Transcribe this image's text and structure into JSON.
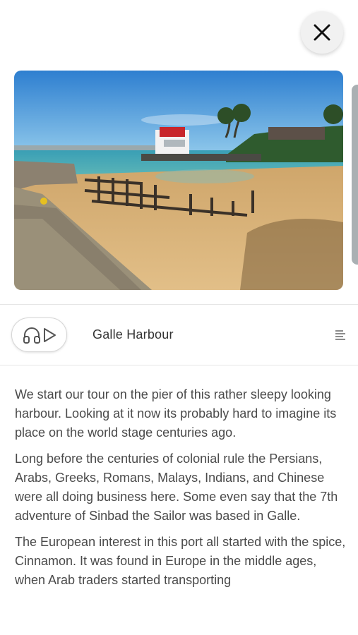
{
  "header": {
    "close_icon": "close-icon"
  },
  "carousel": {
    "photo_alt": "Galle Harbour",
    "colors": {
      "sky": "#3d8fd8",
      "sea": "#3fa6b8",
      "sand": "#d9b47a"
    }
  },
  "player": {
    "audio_icons": [
      "headphones-icon",
      "play-icon"
    ],
    "stop_title": "Galle Harbour",
    "transcript_icon": "text-align-icon"
  },
  "article": {
    "paragraphs": [
      "We start our tour on the pier of this rather sleepy looking harbour. Looking at it now its probably hard to imagine its place on the world stage centuries ago.",
      "Long before the centuries of colonial rule the Persians, Arabs, Greeks, Romans, Malays, Indians, and Chinese were all doing business here. Some even say that the 7th adventure of Sinbad the Sailor was based in Galle.",
      "The European interest in this port all started with the spice, Cinnamon. It was found in Europe in the middle ages, when Arab traders started transporting"
    ]
  }
}
